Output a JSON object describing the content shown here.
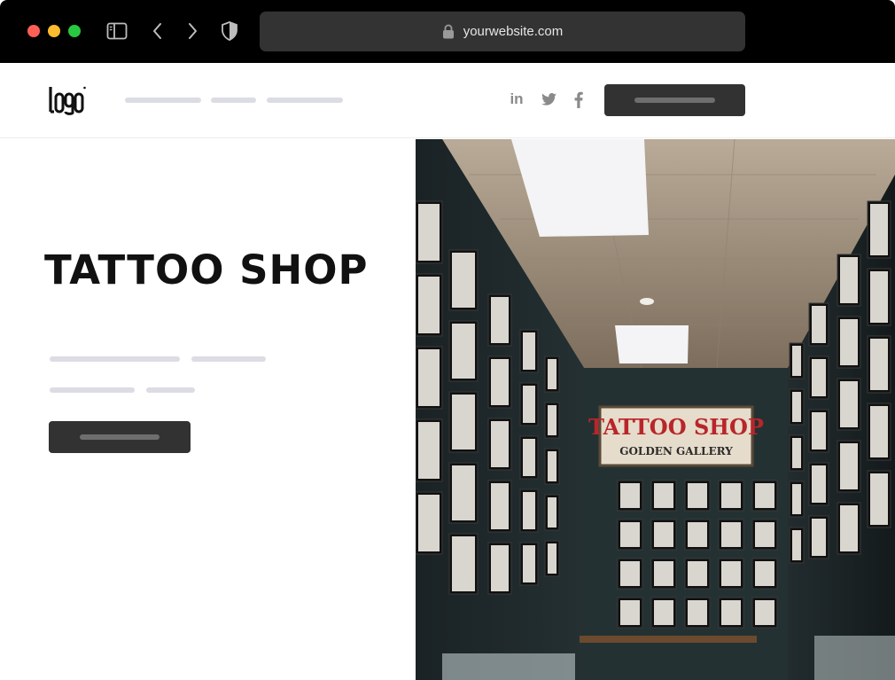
{
  "browser": {
    "url": "yourwebsite.com",
    "icons": [
      "sidebar-icon",
      "chevron-left-icon",
      "chevron-right-icon",
      "shield-icon",
      "lock-icon"
    ]
  },
  "header": {
    "logo_text": "logo",
    "social": [
      {
        "name": "linkedin-icon",
        "label": "in"
      },
      {
        "name": "twitter-icon"
      },
      {
        "name": "facebook-icon",
        "label": "f"
      }
    ]
  },
  "hero": {
    "title": "TATTOO SHOP",
    "image_sign": {
      "line1": "TATTOO SHOP",
      "line2": "GOLDEN GALLERY"
    }
  },
  "colors": {
    "chrome_bg": "#000000",
    "address_bar": "#333333",
    "button_dark": "#323232",
    "placeholder_line": "#dcdce4",
    "title_text": "#111111"
  }
}
